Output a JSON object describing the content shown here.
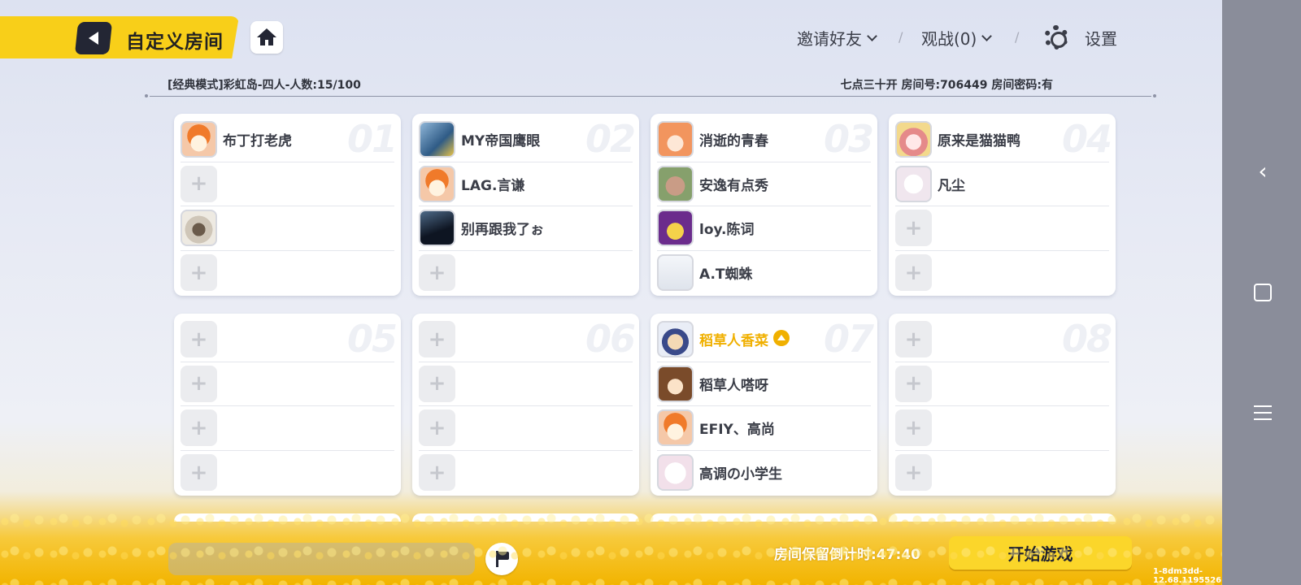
{
  "header": {
    "title": "自定义房间",
    "invite_label": "邀请好友",
    "spectate_label": "观战(0)",
    "settings_label": "设置",
    "separator": "/"
  },
  "room_info": {
    "mode": "[经典模式]彩虹岛-四人-人数:15/100",
    "details": "七点三十开 房间号:706449 房间密码:有"
  },
  "teams": [
    {
      "number": "01",
      "slots": [
        {
          "name": "布丁打老虎",
          "avatar": "tiger-avatar"
        },
        {
          "empty": true
        },
        {
          "name": "",
          "avatar": "dog-photo-avatar"
        },
        {
          "empty": true
        }
      ]
    },
    {
      "number": "02",
      "slots": [
        {
          "name": "MY帝国鹰眼",
          "avatar": "blue-character-avatar"
        },
        {
          "name": "LAG.言谦",
          "avatar": "tiger-avatar"
        },
        {
          "name": "别再跟我了ぉ",
          "avatar": "dark-photo-avatar"
        },
        {
          "empty": true
        }
      ]
    },
    {
      "number": "03",
      "slots": [
        {
          "name": "消逝的青春",
          "avatar": "ginger-girl-avatar"
        },
        {
          "name": "安逸有点秀",
          "avatar": "pig-avatar"
        },
        {
          "name": "loy.陈词",
          "avatar": "purple-hat-avatar"
        },
        {
          "name": "A.T蜘蛛",
          "avatar": "sketch-avatar"
        }
      ]
    },
    {
      "number": "04",
      "slots": [
        {
          "name": "原来是猫猫鸭",
          "avatar": "pink-hair-avatar"
        },
        {
          "name": "凡尘",
          "avatar": "white-hair-avatar"
        },
        {
          "empty": true
        },
        {
          "empty": true
        }
      ]
    },
    {
      "number": "05",
      "slots": [
        {
          "empty": true
        },
        {
          "empty": true
        },
        {
          "empty": true
        },
        {
          "empty": true
        }
      ]
    },
    {
      "number": "06",
      "slots": [
        {
          "empty": true
        },
        {
          "empty": true
        },
        {
          "empty": true
        },
        {
          "empty": true
        }
      ]
    },
    {
      "number": "07",
      "slots": [
        {
          "name": "稻草人香菜",
          "avatar": "straw-avatar",
          "host": true
        },
        {
          "name": "稻草人嗒呀",
          "avatar": "brown-hair-avatar"
        },
        {
          "name": "EFIY、高尚",
          "avatar": "tiger-avatar"
        },
        {
          "name": "高调の小学生",
          "avatar": "blob-avatar"
        }
      ]
    },
    {
      "number": "08",
      "slots": [
        {
          "empty": true
        },
        {
          "empty": true
        },
        {
          "empty": true
        },
        {
          "empty": true
        }
      ]
    }
  ],
  "empty_slot_glyph": "+",
  "footer": {
    "countdown": "房间保留倒计时:47:40",
    "start_label": "开始游戏",
    "version": "1-8dm3dd-12.68.1195526"
  },
  "colors": {
    "accent_yellow": "#f8cf19",
    "host_gold": "#f0b000",
    "dark": "#232634"
  }
}
